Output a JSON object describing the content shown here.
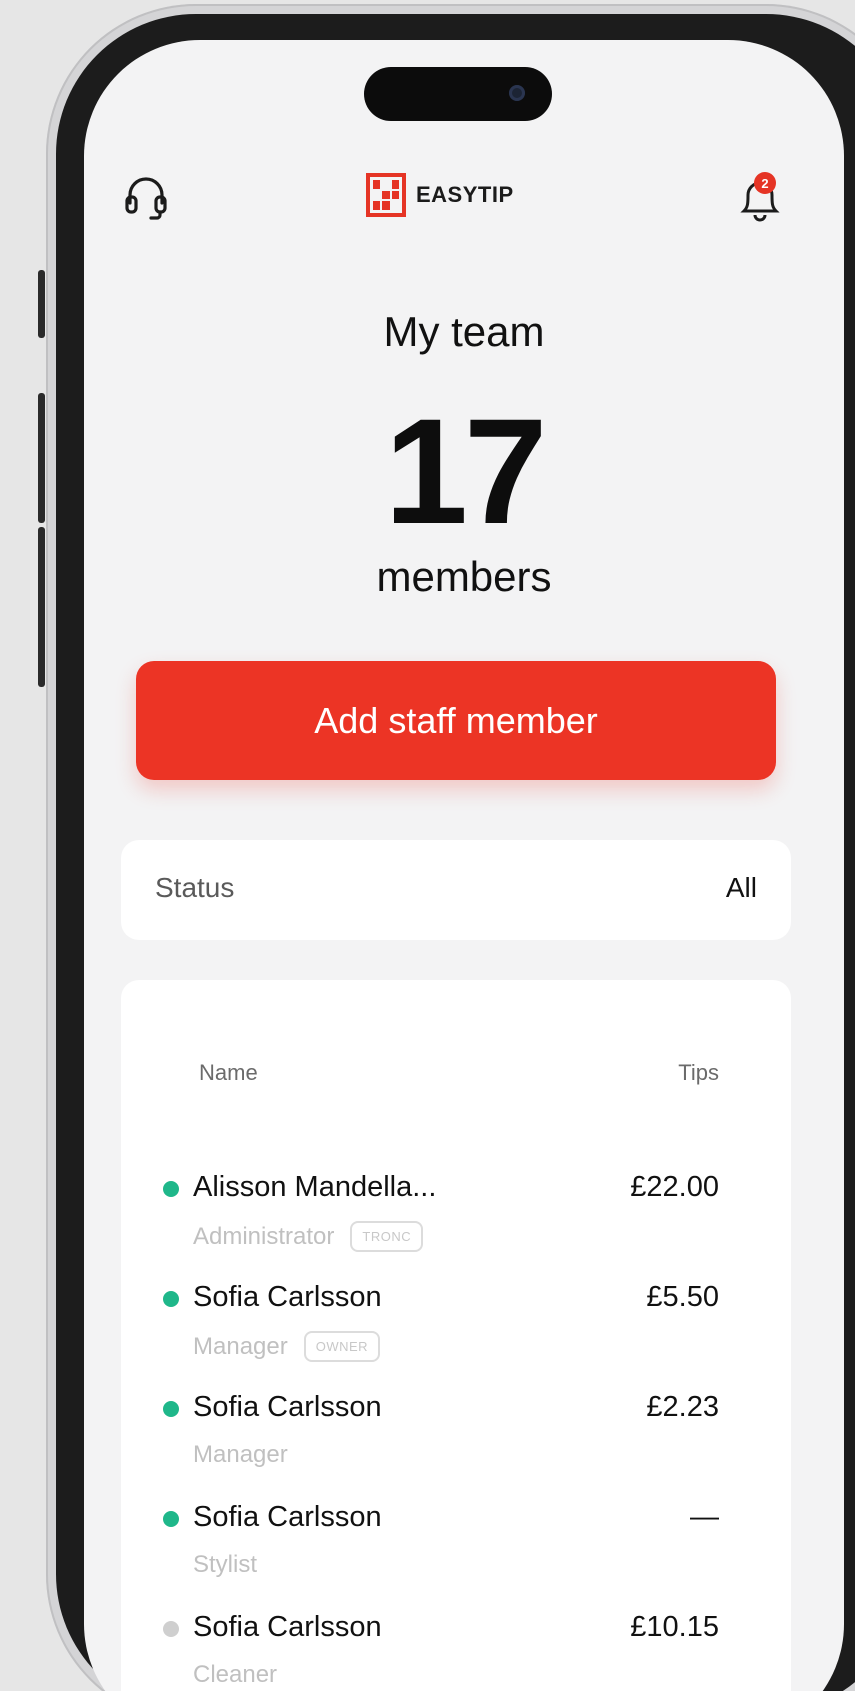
{
  "app": {
    "logo_text": "EASYTIP",
    "notifications_count": "2",
    "accent_color": "#ec3425",
    "active_status_color": "#1fb78a",
    "inactive_status_color": "#cfcfcf"
  },
  "header": {
    "support_icon": "headset-icon",
    "notifications_icon": "bell-icon"
  },
  "team": {
    "title": "My team",
    "count": "17",
    "count_label": "members",
    "add_button_label": "Add staff member"
  },
  "filter": {
    "label": "Status",
    "value": "All"
  },
  "table": {
    "col_name": "Name",
    "col_tips": "Tips",
    "rows": [
      {
        "name": "Alisson Mandella...",
        "role": "Administrator",
        "tag": "TRONC",
        "tips": "£22.00",
        "active": true
      },
      {
        "name": "Sofia Carlsson",
        "role": "Manager",
        "tag": "OWNER",
        "tips": "£5.50",
        "active": true
      },
      {
        "name": "Sofia Carlsson",
        "role": "Manager",
        "tag": "",
        "tips": "£2.23",
        "active": true
      },
      {
        "name": "Sofia Carlsson",
        "role": "Stylist",
        "tag": "",
        "tips": "—",
        "active": true
      },
      {
        "name": "Sofia Carlsson",
        "role": "Cleaner",
        "tag": "",
        "tips": "£10.15",
        "active": false
      }
    ]
  }
}
